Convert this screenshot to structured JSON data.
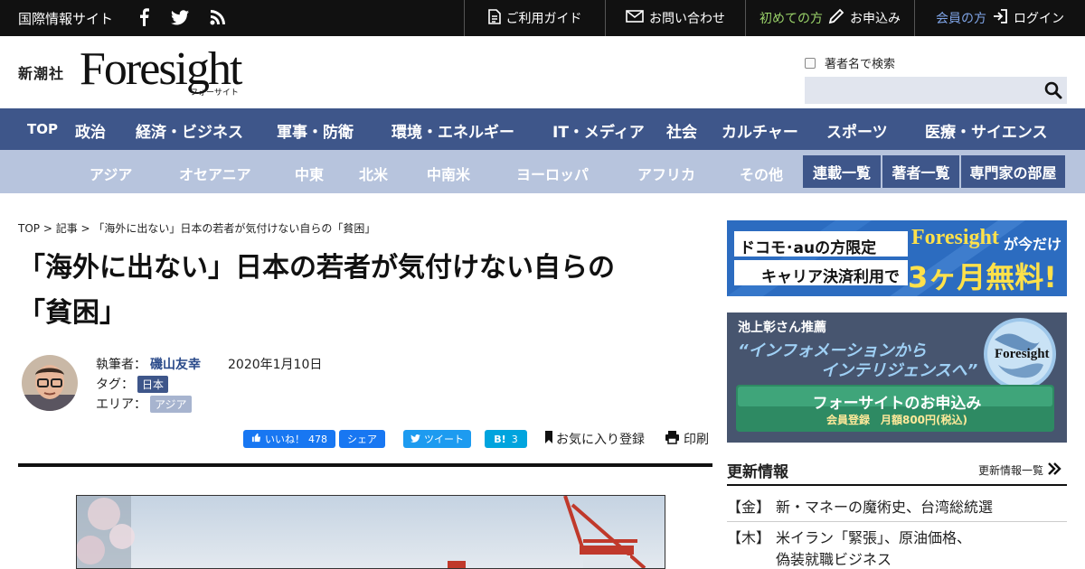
{
  "topbar": {
    "site_label": "国際情報サイト",
    "sns_icons": [
      "facebook-icon",
      "twitter-icon",
      "rss-icon"
    ],
    "guide": "ご利用ガイド",
    "contact": "お問い合わせ",
    "first_time": "初めての方",
    "signup": "お申込み",
    "member": "会員の方",
    "login": "ログイン"
  },
  "header": {
    "publisher": "新潮社",
    "logo": "Foresight",
    "logo_sub": "フォーサイト",
    "search_checkbox_label": "著者名で検索",
    "search_value": ""
  },
  "mainnav": [
    "TOP",
    "政治",
    "経済・ビジネス",
    "軍事・防衛",
    "環境・エネルギー",
    "IT・メディア",
    "社会",
    "カルチャー",
    "スポーツ",
    "医療・サイエンス"
  ],
  "regionnav": {
    "regions": [
      "アジア",
      "オセアニア",
      "中東",
      "北米",
      "中南米",
      "ヨーロッパ",
      "アフリカ",
      "その他"
    ],
    "buttons": [
      "連載一覧",
      "著者一覧",
      "専門家の部屋"
    ]
  },
  "article": {
    "breadcrumb": "TOP > 記事 > 「海外に出ない」日本の若者が気付けない自らの「貧困」",
    "title_line1": "「海外に出ない」日本の若者が気付けない自らの",
    "title_line2": "「貧困」",
    "author_label": "執筆者：",
    "author": "磯山友幸",
    "date": "2020年1月10日",
    "tag_label": "タグ：",
    "tag": "日本",
    "area_label": "エリア：",
    "area": "アジア"
  },
  "share": {
    "fb_like": "いいね！",
    "fb_like_count": "478",
    "fb_share": "シェア",
    "tweet": "ツイート",
    "hatena": "B!",
    "hatena_count": "3",
    "favorite": "お気に入り登録",
    "print": "印刷"
  },
  "sidebar": {
    "banner1_line1": "ドコモ･auの方限定",
    "banner1_line2": "キャリア決済利用で",
    "banner1_brand": "Foresight",
    "banner1_suffix": "が今だけ",
    "banner1_offer": "3ヶ月無料!",
    "banner2_recommend": "池上彰さん推薦",
    "banner2_quote1": "“インフォメーションから",
    "banner2_quote2": "インテリジェンスへ”",
    "banner2_logo": "Foresight",
    "banner2_cta": "フォーサイトのお申込み",
    "banner2_cta_sub": "会員登録　月額800円(税込)",
    "updates_title": "更新情報",
    "updates_more": "更新情報一覧",
    "news": [
      {
        "day": "【金】",
        "text": "新・マネーの魔術史、台湾総統選"
      },
      {
        "day": "【木】",
        "text": "米イラン「緊張」、原油価格、",
        "text2": "偽装就職ビジネス"
      }
    ]
  }
}
